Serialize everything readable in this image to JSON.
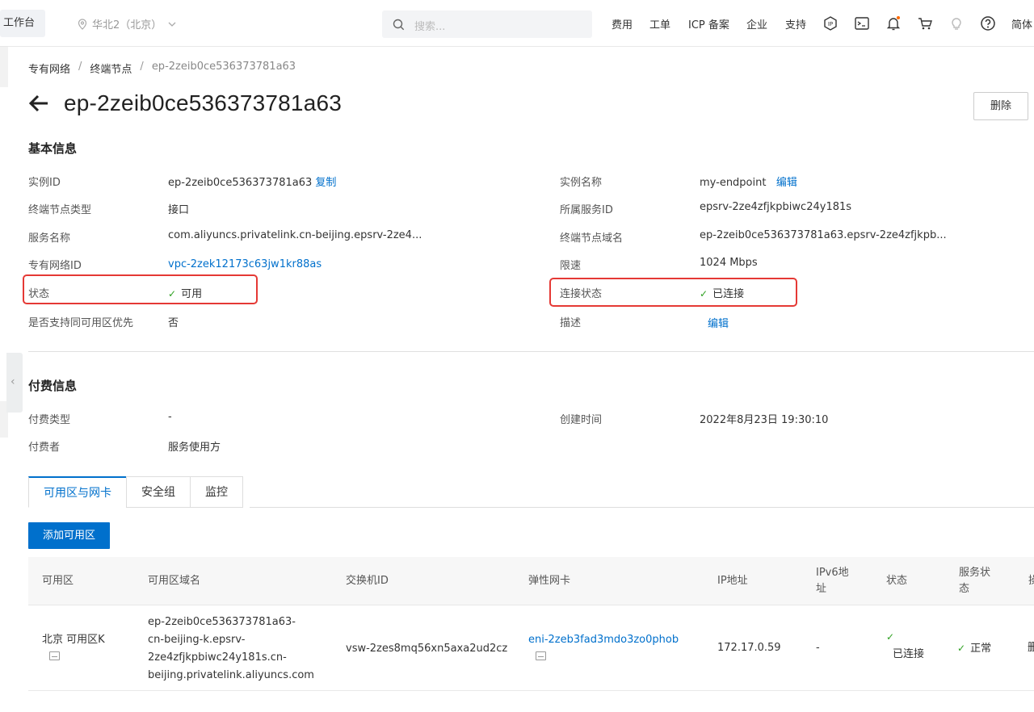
{
  "topbar": {
    "workbench": "工作台",
    "region": "华北2（北京）",
    "search_placeholder": "搜索...",
    "nav": [
      "费用",
      "工单",
      "ICP 备案",
      "企业",
      "支持"
    ],
    "lang": "简体"
  },
  "breadcrumb": [
    "专有网络",
    "终端节点",
    "ep-2zeib0ce536373781a63"
  ],
  "page_title": "ep-2zeib0ce536373781a63",
  "delete_label": "删除",
  "basic": {
    "title": "基本信息",
    "instance_id_label": "实例ID",
    "instance_id": "ep-2zeib0ce536373781a63",
    "copy": "复制",
    "instance_name_label": "实例名称",
    "instance_name": "my-endpoint",
    "edit": "编辑",
    "type_label": "终端节点类型",
    "type": "接口",
    "service_id_label": "所属服务ID",
    "service_id": "epsrv-2ze4zfjkpbiwc24y181s",
    "service_name_label": "服务名称",
    "service_name": "com.aliyuncs.privatelink.cn-beijing.epsrv-2ze4...",
    "domain_label": "终端节点域名",
    "domain": "ep-2zeib0ce536373781a63.epsrv-2ze4zfjkpb...",
    "vpc_label": "专有网络ID",
    "vpc": "vpc-2zek12173c63jw1kr88as",
    "rate_label": "限速",
    "rate": "1024 Mbps",
    "status_label": "状态",
    "status": "可用",
    "conn_label": "连接状态",
    "conn": "已连接",
    "same_zone_label": "是否支持同可用区优先",
    "same_zone": "否",
    "desc_label": "描述",
    "desc_edit": "编辑"
  },
  "billing": {
    "title": "付费信息",
    "type_label": "付费类型",
    "type": "-",
    "created_label": "创建时间",
    "created": "2022年8月23日 19:30:10",
    "payer_label": "付费者",
    "payer": "服务使用方"
  },
  "tabs": [
    "可用区与网卡",
    "安全组",
    "监控"
  ],
  "add_zone": "添加可用区",
  "table": {
    "headers": [
      "可用区",
      "可用区域名",
      "交换机ID",
      "弹性网卡",
      "IP地址",
      "IPv6地址",
      "状态",
      "服务状态",
      "操"
    ],
    "rows": [
      {
        "zone": "北京 可用区K",
        "domain_l1": "ep-2zeib0ce536373781a63-",
        "domain_l2": "cn-beijing-k.epsrv-",
        "domain_l3": "2ze4zfjkpbiwc24y181s.cn-",
        "domain_l4": "beijing.privatelink.aliyuncs.com",
        "vsw": "vsw-2zes8mq56xn5axa2ud2cz",
        "eni": "eni-2zeb3fad3mdo3zo0phob",
        "ip": "172.17.0.59",
        "ipv6": "-",
        "status": "已连接",
        "svc_status": "正常",
        "op": "删"
      }
    ]
  },
  "colors": {
    "accent": "#0070cc",
    "success": "#2ea121",
    "highlight": "#e53935"
  }
}
